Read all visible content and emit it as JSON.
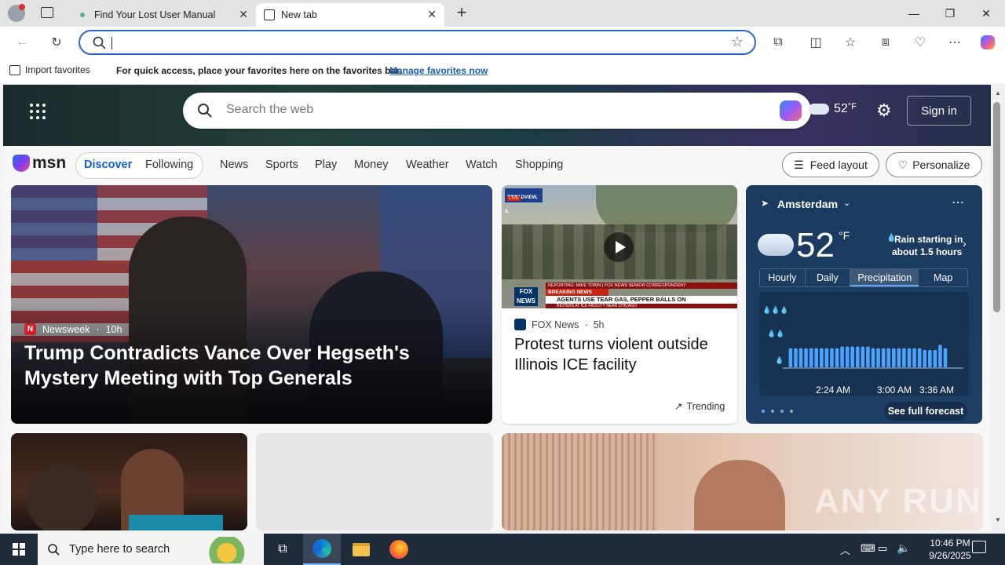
{
  "tabs": [
    {
      "title": "Find Your Lost User Manual"
    },
    {
      "title": "New tab"
    }
  ],
  "favorites_bar": {
    "import_label": "Import favorites",
    "message": "For quick access, place your favorites here on the favorites bar.",
    "manage_link": "Manage favorites now"
  },
  "msn": {
    "search_placeholder": "Search the web",
    "temperature": "52",
    "temp_unit": "°F",
    "sign_in": "Sign in",
    "logo_text": "msn",
    "nav": {
      "pills": [
        "Discover",
        "Following"
      ],
      "links": [
        "News",
        "Sports",
        "Play",
        "Money",
        "Weather",
        "Watch",
        "Shopping"
      ],
      "feed_layout": "Feed layout",
      "personalize": "Personalize"
    },
    "main_story": {
      "source": "Newsweek",
      "age": "10h",
      "headline": "Trump Contradicts Vance Over Hegseth's Mystery Meeting with Top Generals"
    },
    "video_story": {
      "tv_top": "BROADVIEW, IL",
      "tv_live": "LIVE",
      "tv_reporting": "REPORTING: MIKE TOBIN | FOX NEWS SENIOR CORRESPONDENT",
      "tv_sub": "RIOTERS AT ICE FACILITY NEAR CHICAGO",
      "breaking": "BREAKING NEWS",
      "ticker": "AGENTS USE TEAR GAS, PEPPER BALLS ON",
      "source": "FOX News",
      "age": "5h",
      "headline": "Protest turns violent outside Illinois ICE facility",
      "trending": "Trending"
    },
    "weather": {
      "city": "Amsterdam",
      "temp": "52",
      "unit": "°F",
      "rain_line1": "Rain starting in",
      "rain_line2": "about 1.5 hours",
      "tabs": [
        "Hourly",
        "Daily",
        "Precipitation",
        "Map"
      ],
      "active_tab": "Precipitation",
      "times": [
        "2:24 AM",
        "3:00 AM",
        "3:36 AM"
      ],
      "see_forecast": "See full forecast",
      "precip_levels": [
        0.0,
        0.55,
        0.55,
        0.55,
        0.55,
        0.55,
        0.55,
        0.55,
        0.55,
        0.55,
        0.55,
        0.6,
        0.6,
        0.6,
        0.6,
        0.6,
        0.6,
        0.55,
        0.55,
        0.55,
        0.55,
        0.55,
        0.55,
        0.55,
        0.55,
        0.55,
        0.55,
        0.5,
        0.5,
        0.5,
        0.65,
        0.55,
        0.0,
        0.0,
        0.0
      ]
    },
    "watermark": "ANY RUN"
  },
  "taskbar": {
    "search_placeholder": "Type here to search",
    "time": "10:46 PM",
    "date": "9/26/2025"
  },
  "colors": {
    "accent": "#2a68c6",
    "hero_dark": "#1d3a45",
    "weather_bg": "#1b3a5e",
    "taskbar": "#1f2a3a",
    "newsweek_red": "#d62027",
    "fox_blue": "#003366"
  }
}
